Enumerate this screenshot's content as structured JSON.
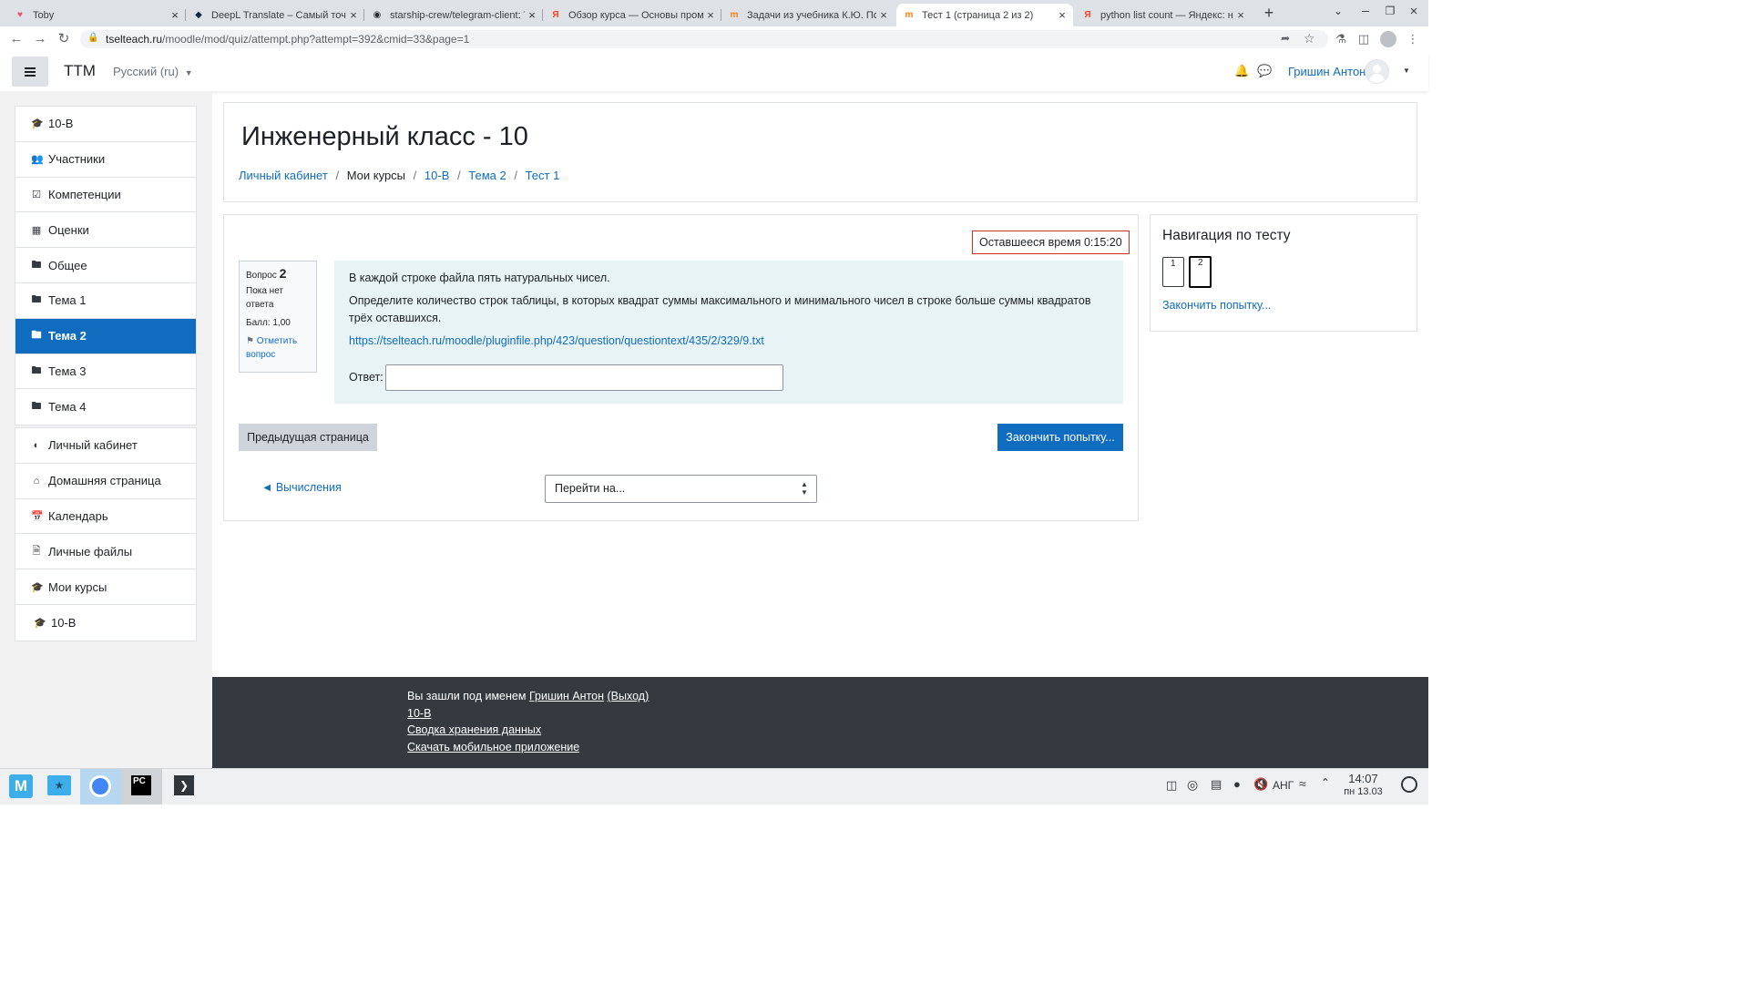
{
  "browser": {
    "tabs": [
      {
        "title": "Toby",
        "icon": "toby-icon",
        "color": "#e8566c"
      },
      {
        "title": "DeepL Translate – Самый точный",
        "icon": "deepl-icon",
        "color": "#0f2b46"
      },
      {
        "title": "starship-crew/telegram-client: Te",
        "icon": "github-icon",
        "color": "#24292f"
      },
      {
        "title": "Обзор курса — Основы промы",
        "icon": "yandex-icon",
        "color": "#fc3f1d"
      },
      {
        "title": "Задачи из учебника К.Ю. Поляк",
        "icon": "moodle-icon",
        "color": "#f98012"
      },
      {
        "title": "Тест 1 (страница 2 из 2)",
        "icon": "moodle-icon",
        "color": "#f98012"
      },
      {
        "title": "python list count — Яндекс: нащ",
        "icon": "yandex-icon",
        "color": "#fc3f1d"
      }
    ],
    "url_host": "tselteach.ru",
    "url_path": "/moodle/mod/quiz/attempt.php?attempt=392&cmid=33&page=1"
  },
  "navbar": {
    "site_name": "ТТМ",
    "language": "Русский (ru)",
    "user_name": "Гришин Антон"
  },
  "sidebar": {
    "course_items": [
      {
        "label": "10-В",
        "icon": "graduation-cap-icon"
      },
      {
        "label": "Участники",
        "icon": "users-icon"
      },
      {
        "label": "Компетенции",
        "icon": "checkbox-icon"
      },
      {
        "label": "Оценки",
        "icon": "table-icon"
      },
      {
        "label": "Общее",
        "icon": "folder-icon"
      },
      {
        "label": "Тема 1",
        "icon": "folder-icon"
      },
      {
        "label": "Тема 2",
        "icon": "folder-icon",
        "active": true
      },
      {
        "label": "Тема 3",
        "icon": "folder-icon"
      },
      {
        "label": "Тема 4",
        "icon": "folder-icon"
      }
    ],
    "site_items": [
      {
        "label": "Личный кабинет",
        "icon": "dashboard-icon"
      },
      {
        "label": "Домашняя страница",
        "icon": "home-icon"
      },
      {
        "label": "Календарь",
        "icon": "calendar-icon"
      },
      {
        "label": "Личные файлы",
        "icon": "file-icon"
      },
      {
        "label": "Мои курсы",
        "icon": "graduation-cap-icon"
      },
      {
        "label": "10-В",
        "icon": "graduation-cap-icon",
        "sub": true
      }
    ]
  },
  "header": {
    "course_title": "Инженерный класс - 10",
    "breadcrumb": [
      {
        "label": "Личный кабинет",
        "link": true
      },
      {
        "label": "Мои курсы",
        "link": false
      },
      {
        "label": "10-В",
        "link": true
      },
      {
        "label": "Тема 2",
        "link": true
      },
      {
        "label": "Тест 1",
        "link": true
      }
    ]
  },
  "quiz": {
    "timer_label": "Оставшееся время",
    "timer_value": "0:15:20",
    "question_label": "Вопрос",
    "question_number": "2",
    "status": "Пока нет ответа",
    "score": "Балл: 1,00",
    "flag_label": "Отметить вопрос",
    "text_line1": "В каждой строке файла пять натуральных чисел.",
    "text_line2": "Определите количество строк таблицы, в которых квадрат суммы максимального и минимального чисел в строке больше суммы квадратов трёх оставшихся.",
    "file_link": "https://tselteach.ru/moodle/pluginfile.php/423/question/questiontext/435/2/329/9.txt",
    "answer_label": "Ответ:",
    "answer_value": "",
    "prev_button": "Предыдущая страница",
    "finish_button": "Закончить попытку...",
    "prev_activity": "◄ Вычисления",
    "jump_placeholder": "Перейти на..."
  },
  "quiz_nav": {
    "title": "Навигация по тесту",
    "buttons": [
      "1",
      "2"
    ],
    "current": "2",
    "finish_link": "Закончить попытку..."
  },
  "footer": {
    "logged_in_prefix": "Вы зашли под именем",
    "user_name": "Гришин Антон",
    "logout": "(Выход)",
    "course": "10-В",
    "data_summary": "Сводка хранения данных",
    "mobile_app": "Скачать мобильное приложение"
  },
  "taskbar": {
    "keyboard_layout": "АНГ",
    "time": "14:07",
    "date": "пн 13.03"
  },
  "colors": {
    "primary": "#0f6cbf",
    "timer_border": "#ca3120",
    "question_bg": "#e7f3f5",
    "footer_bg": "#343a40"
  }
}
